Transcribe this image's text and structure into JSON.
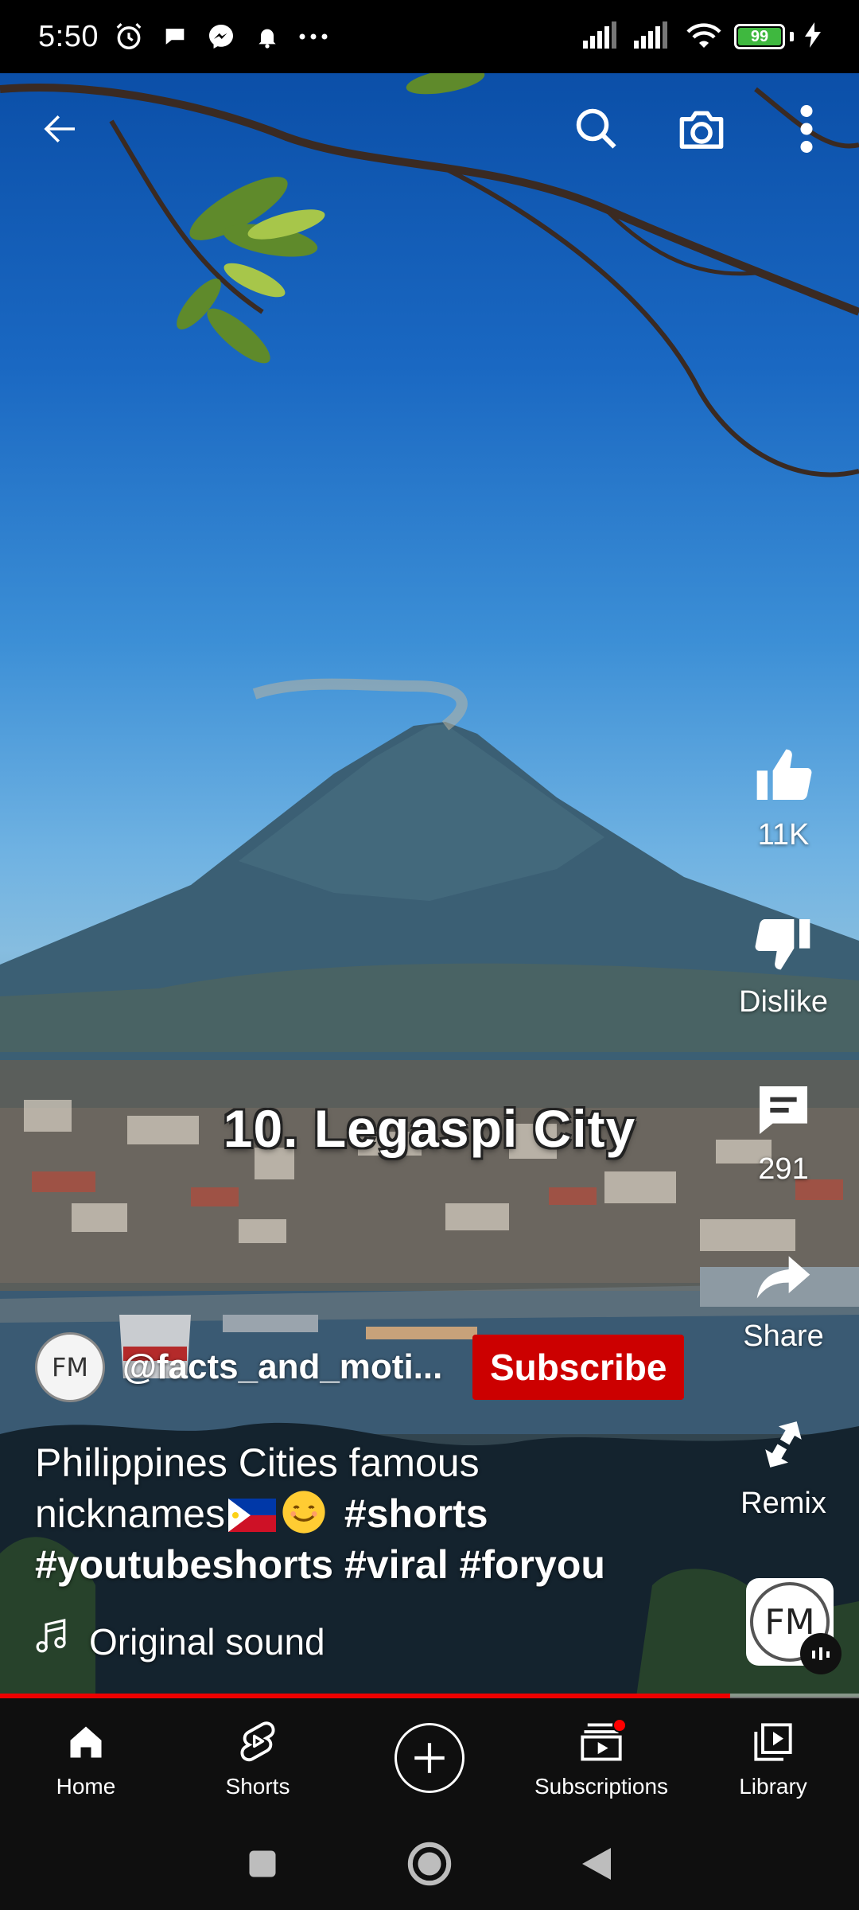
{
  "status_bar": {
    "time": "5:50",
    "battery_level": "99",
    "notification_icons": [
      "alarm-icon",
      "chat-bubble-icon",
      "messenger-icon",
      "bell-icon",
      "more-dots-icon"
    ],
    "system_icons": [
      "signal-icon",
      "signal-icon",
      "wifi-icon",
      "battery-icon",
      "charging-icon"
    ]
  },
  "top_controls": {
    "icons": [
      "back-arrow-icon",
      "search-icon",
      "camera-icon",
      "more-vert-icon"
    ]
  },
  "video": {
    "overlay_caption": "10. Legaspi City",
    "progress_fraction": 0.85
  },
  "actions": {
    "like_count": "11K",
    "dislike_label": "Dislike",
    "comment_count": "291",
    "share_label": "Share",
    "remix_label": "Remix"
  },
  "channel": {
    "avatar_initials": "FM",
    "handle": "@facts_and_moti...",
    "subscribe_label": "Subscribe"
  },
  "description": {
    "line_text_1": "Philippines Cities famous",
    "line_text_2": "nicknames",
    "hashtag_1": "#shorts",
    "hashtag_2": "#youtubeshorts",
    "hashtag_3": "#viral",
    "hashtag_4": "#foryou"
  },
  "sound": {
    "label": "Original sound",
    "thumb_initials": "FM"
  },
  "bottom_nav": {
    "items": [
      {
        "label": "Home",
        "icon": "home-icon"
      },
      {
        "label": "Shorts",
        "icon": "shorts-icon"
      },
      {
        "label": "",
        "icon": "create-plus-icon"
      },
      {
        "label": "Subscriptions",
        "icon": "subscriptions-icon"
      },
      {
        "label": "Library",
        "icon": "library-icon"
      }
    ]
  },
  "colors": {
    "subscribe_red": "#cc0000",
    "progress_red": "#ee0000",
    "nav_background": "#0f0f0f",
    "battery_green": "#3fb83f"
  }
}
